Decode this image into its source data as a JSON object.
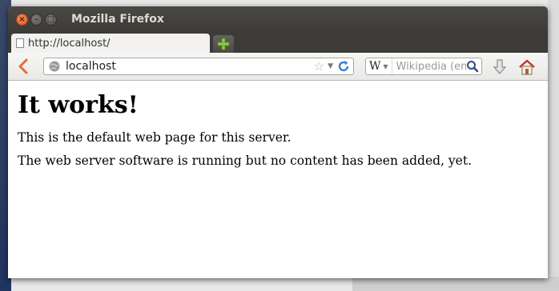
{
  "window": {
    "title": "Mozilla Firefox"
  },
  "tabs": [
    {
      "label": "http://localhost/"
    }
  ],
  "toolbar": {
    "url": "localhost",
    "search_engine": "W",
    "search_placeholder": "Wikipedia (en)"
  },
  "page": {
    "heading": "It works!",
    "paragraphs": [
      "This is the default web page for this server.",
      "The web server software is running but no content has been added, yet."
    ]
  }
}
